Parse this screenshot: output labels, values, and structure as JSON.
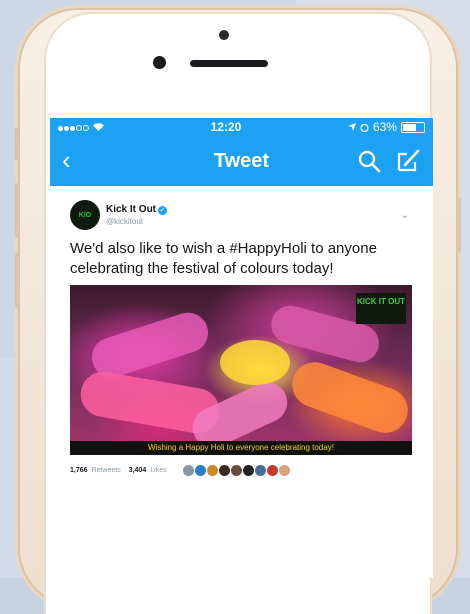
{
  "status_bar": {
    "time": "12:20",
    "battery": "63%"
  },
  "nav": {
    "title": "Tweet",
    "back_icon": "chevron-left-icon",
    "search_icon": "search-icon",
    "compose_icon": "compose-icon"
  },
  "tweet": {
    "display_name": "Kick It Out",
    "handle": "@kickitout",
    "text": "We'd also like to wish a #HappyHoli to anyone celebrating the festival of colours today!",
    "image_logo": "KICK IT OUT",
    "image_caption": "Wishing a Happy Holi to everyone celebrating today!",
    "retweets_count": "1,766",
    "retweets_label": "Retweets",
    "likes_count": "3,404",
    "likes_label": "Likes"
  },
  "colors": {
    "twitter_blue": "#1da1f2",
    "phone_gold": "#eedfcf"
  }
}
